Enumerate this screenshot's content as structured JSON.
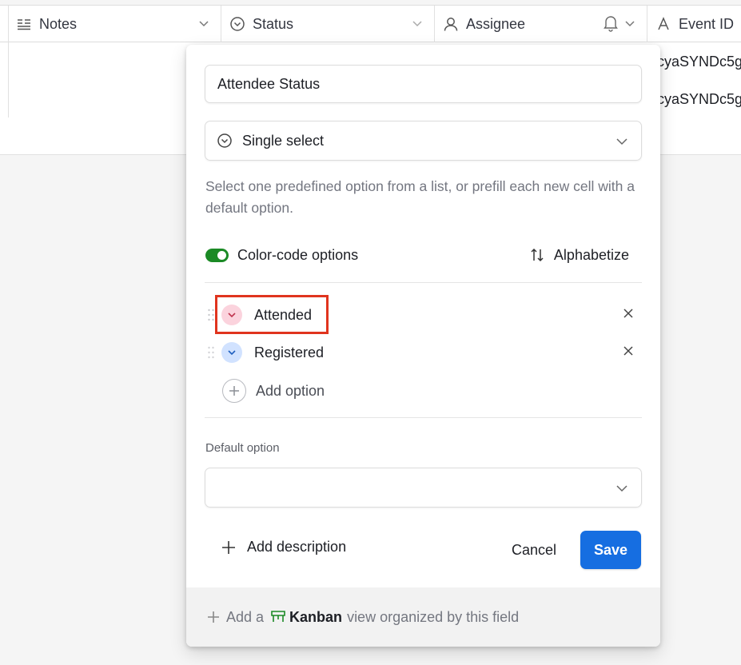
{
  "grid": {
    "columns": [
      {
        "label": "Notes",
        "icon": "long-text-icon"
      },
      {
        "label": "Status",
        "icon": "single-select-icon"
      },
      {
        "label": "Assignee",
        "icon": "user-icon"
      },
      {
        "label": "Event ID",
        "icon": "text-icon"
      }
    ],
    "rows": [
      {
        "event_id": "cyaSYNDc5g"
      },
      {
        "event_id": "cyaSYNDc5g"
      }
    ]
  },
  "field_editor": {
    "field_name": "Attendee Status",
    "field_type": "Single select",
    "help_text": "Select one predefined option from a list, or prefill each new cell with a default option.",
    "color_code_label": "Color-code options",
    "color_code_enabled": true,
    "alphabetize_label": "Alphabetize",
    "options": [
      {
        "label": "Attended",
        "color": "#fbd3dd",
        "chevron_color": "#c0354f"
      },
      {
        "label": "Registered",
        "color": "#d1e2ff",
        "chevron_color": "#1f5fbf"
      }
    ],
    "add_option_label": "Add option",
    "default_option_label": "Default option",
    "default_option_value": "",
    "add_description_label": "Add description",
    "cancel_label": "Cancel",
    "save_label": "Save",
    "footer": {
      "prefix": "Add a",
      "view_name": "Kanban",
      "suffix": "view organized by this field"
    }
  },
  "colors": {
    "accent": "#166ee1",
    "toggle_on": "#1b8a25",
    "highlight": "#e0341e",
    "kanban_icon": "#1b8a25"
  }
}
